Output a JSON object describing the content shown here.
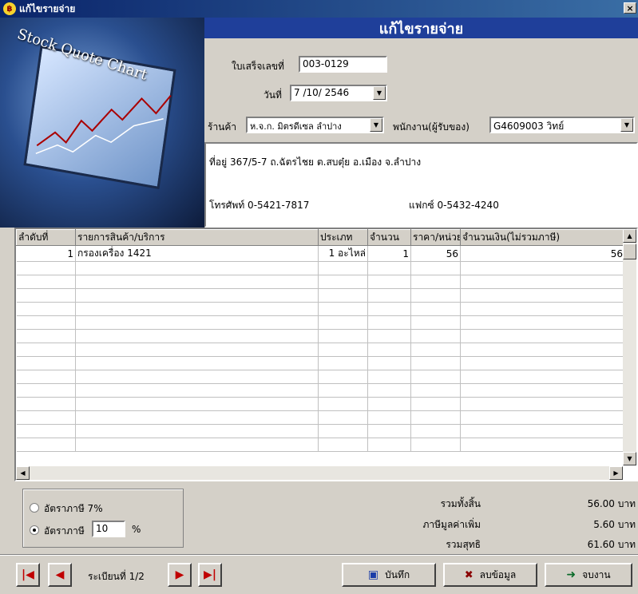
{
  "window": {
    "title": "แก้ไขรายจ่าย",
    "close_glyph": "×"
  },
  "photo": {
    "caption": "Stock Quote Chart"
  },
  "form": {
    "header": "แก้ไขรายจ่าย",
    "receipt_label": "ใบเสร็จเลขที่",
    "receipt_value": "003-0129",
    "date_label": "วันที่",
    "date_value": "7 /10/ 2546",
    "store_label": "ร้านค้า",
    "store_value": "ห.จ.ก. มิตรดีเซล ลำปาง",
    "employee_label": "พนักงาน(ผู้รับของ)",
    "employee_value": "G4609003 วิทย์",
    "address": "ที่อยู่  367/5-7 ถ.ฉัตรไชย ต.สบตุ๋ย อ.เมือง จ.ลำปาง",
    "phone": "โทรศัพท์  0-5421-7817",
    "fax": "แฟกซ์   0-5432-4240"
  },
  "grid": {
    "columns": [
      "ลำดับที่",
      "รายการสินค้า/บริการ",
      "ประเภท",
      "จำนวน",
      "ราคา/หน่วย",
      "จำนวนเงิน(ไม่รวมภาษี)"
    ],
    "rows": [
      {
        "no": "1",
        "item": "กรองเครื่อง 1421",
        "type": "1 อะไหล่",
        "qty": "1",
        "price": "56",
        "amount": "56"
      }
    ]
  },
  "tax": {
    "option1_label": "อัตราภาษี 7%",
    "option2_label": "อัตราภาษี",
    "rate_value": "10",
    "percent_sign": "%"
  },
  "totals": {
    "total_label": "รวมทั้งสิ้น",
    "total_value": "56.00 บาท",
    "vat_label": "ภาษีมูลค่าเพิ่ม",
    "vat_value": "5.60 บาท",
    "net_label": "รวมสุทธิ",
    "net_value": "61.60 บาท"
  },
  "footer": {
    "record_label": "ระเบียนที่ 1/2",
    "save_label": "บันทึก",
    "delete_label": "ลบข้อมูล",
    "exit_label": "จบงาน"
  }
}
